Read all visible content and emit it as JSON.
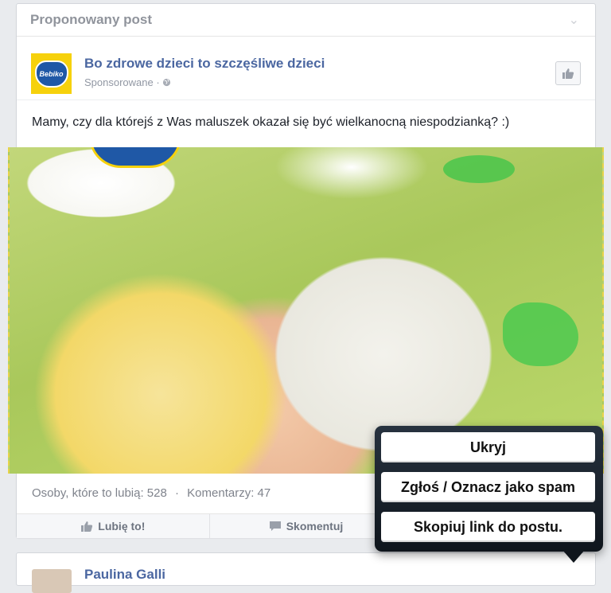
{
  "card": {
    "header_title": "Proponowany post"
  },
  "post": {
    "page_name": "Bo zdrowe dzieci to szczęśliwe dzieci",
    "sponsored_label": "Sponsorowane",
    "sponsored_separator": "·",
    "logo_text": "Bebiko",
    "message": "Mamy, czy dla którejś z Was maluszek okazał się być wielkanocną niespodzianką? :)"
  },
  "stats": {
    "likes_label": "Osoby, które to lubią: 528",
    "separator": "·",
    "comments_label": "Komentarzy: 47"
  },
  "actions": {
    "like_label": "Lubię to!",
    "comment_label": "Skomentuj"
  },
  "next_post": {
    "name": "Paulina Galli"
  },
  "popover": {
    "hide_label": "Ukryj",
    "report_label": "Zgłoś / Oznacz jako spam",
    "copy_link_label": "Skopiuj link do postu."
  },
  "colors": {
    "link_blue": "#4b67a1",
    "brand_yellow": "#f6d10c",
    "brand_blue": "#1f58a6",
    "popover_dark": "#1a232e"
  },
  "icons": [
    "chevron-down-icon",
    "globe-icon",
    "thumbs-up-icon",
    "comment-icon"
  ]
}
